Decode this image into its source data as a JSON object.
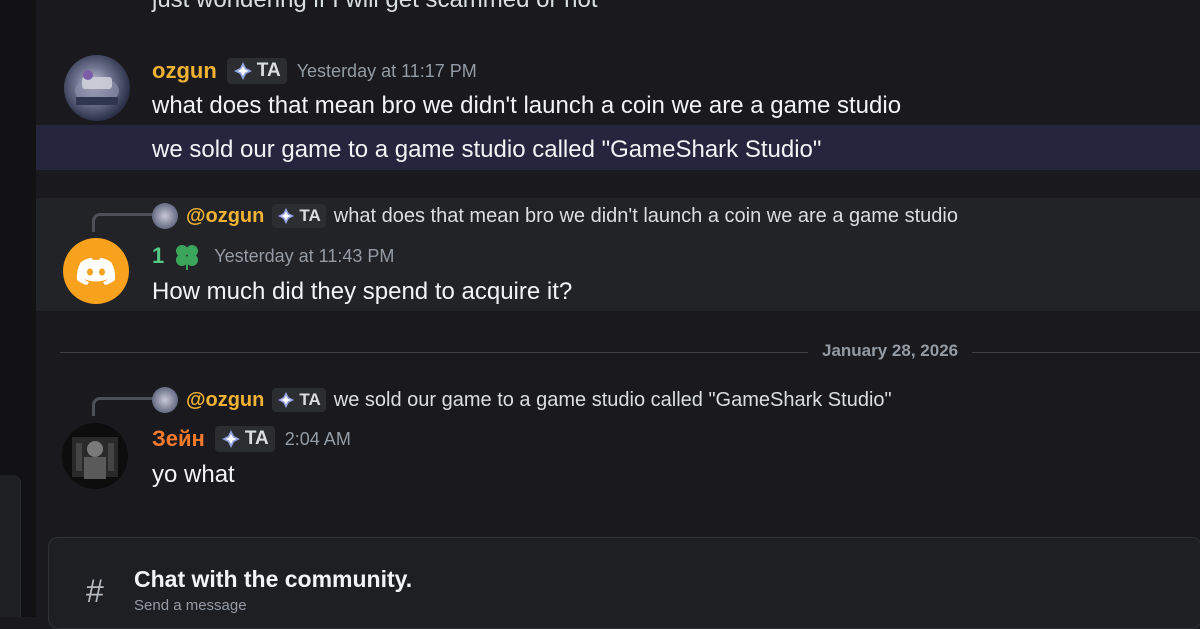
{
  "top_cut_message": "just wondering if I will get scammed or not",
  "messages": [
    {
      "author": "ozgun",
      "tag": "TA",
      "timestamp": "Yesterday at 11:17 PM",
      "lines": [
        "what does that mean bro we didn't launch a  coin we are a game studio",
        "we sold our game to a game studio called \"GameShark Studio\""
      ]
    },
    {
      "reply": {
        "name": "@ozgun",
        "tag": "TA",
        "text": "what does that mean bro we didn't launch a  coin we are a game studio"
      },
      "author": "1",
      "timestamp": "Yesterday at 11:43 PM",
      "text": "How much did they spend to acquire it?"
    },
    {
      "reply": {
        "name": "@ozgun",
        "tag": "TA",
        "text": "we sold our game to a game studio called \"GameShark Studio\""
      },
      "author": "Зейн",
      "tag": "TA",
      "timestamp": "2:04 AM",
      "text": "yo what"
    }
  ],
  "date_divider": "January 28, 2026",
  "composer": {
    "title": "Chat with the community.",
    "subtitle": "Send a message",
    "icon": "#"
  },
  "colors": {
    "ozgun": "#f0b232",
    "user1": "#57c785",
    "zein": "#f47b2c",
    "highlight": "#25263e",
    "discord_avatar_bg": "#f8a11c"
  },
  "icons": [
    "tag-diamond-icon",
    "discord-logo-icon",
    "clover-icon",
    "hash-icon"
  ]
}
